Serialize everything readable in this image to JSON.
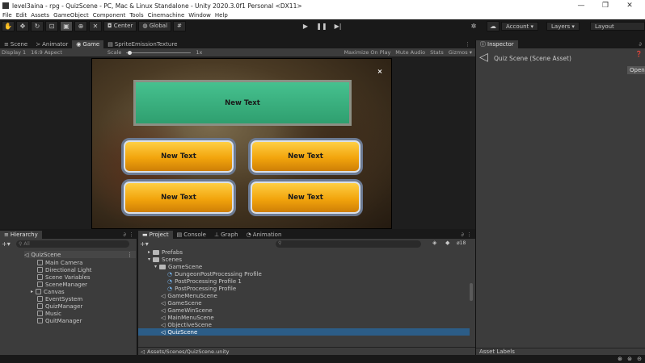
{
  "window": {
    "title": "level3aina - rpg - QuizScene - PC, Mac & Linux Standalone - Unity 2020.3.0f1 Personal <DX11>",
    "controls": [
      "—",
      "❐",
      "✕"
    ]
  },
  "menu": [
    "File",
    "Edit",
    "Assets",
    "GameObject",
    "Component",
    "Tools",
    "Cinemachine",
    "Window",
    "Help"
  ],
  "toolbar": {
    "pivot_label": "Center",
    "space_label": "Global",
    "account_label": "Account ▾",
    "layers_label": "Layers ▾",
    "layout_label": "Layout"
  },
  "top_tabs": {
    "scene": "Scene",
    "animator": "Animator",
    "game": "Game",
    "sprite": "SpriteEmissionTexture",
    "inspector": "Inspector"
  },
  "game_bar": {
    "display": "Display 1",
    "aspect": "16:9 Aspect",
    "scale_label": "Scale",
    "scale_value": "1x",
    "maximize": "Maximize On Play",
    "mute": "Mute Audio",
    "stats": "Stats",
    "gizmos": "Gizmos ▾"
  },
  "game": {
    "banner_text": "New Text",
    "buttons": [
      "New Text",
      "New Text",
      "New Text",
      "New Text"
    ],
    "close": "×"
  },
  "inspector": {
    "title": "Quiz Scene (Scene Asset)",
    "open_button": "Open",
    "asset_labels": "Asset Labels"
  },
  "hierarchy": {
    "tab": "Hierarchy",
    "search_placeholder": "All",
    "scene": "QuizScene",
    "items": [
      "Main Camera",
      "Directional Light",
      "Scene Variables",
      "SceneManager",
      "Canvas",
      "EventSystem",
      "QuizManager",
      "Music",
      "QuitManager"
    ]
  },
  "project": {
    "tabs": [
      "Project",
      "Console",
      "Graph",
      "Animation"
    ],
    "count": "18",
    "rows": [
      {
        "label": "Prefabs",
        "indent": 1,
        "kind": "folder"
      },
      {
        "label": "Scenes",
        "indent": 1,
        "kind": "folder"
      },
      {
        "label": "GameScene",
        "indent": 2,
        "kind": "folder"
      },
      {
        "label": "DungeonPostProcessing Profile",
        "indent": 3,
        "kind": "profile"
      },
      {
        "label": "PostProcessing Profile 1",
        "indent": 3,
        "kind": "profile"
      },
      {
        "label": "PostProcessing Profile",
        "indent": 3,
        "kind": "profile"
      },
      {
        "label": "GameMenuScene",
        "indent": 2,
        "kind": "scene"
      },
      {
        "label": "GameScene",
        "indent": 2,
        "kind": "scene"
      },
      {
        "label": "GameWinScene",
        "indent": 2,
        "kind": "scene"
      },
      {
        "label": "MainMenuScene",
        "indent": 2,
        "kind": "scene"
      },
      {
        "label": "ObjectiveScene",
        "indent": 2,
        "kind": "scene"
      },
      {
        "label": "QuizScene",
        "indent": 2,
        "kind": "scene",
        "selected": true
      }
    ],
    "path": "Assets/Scenes/QuizScene.unity"
  }
}
